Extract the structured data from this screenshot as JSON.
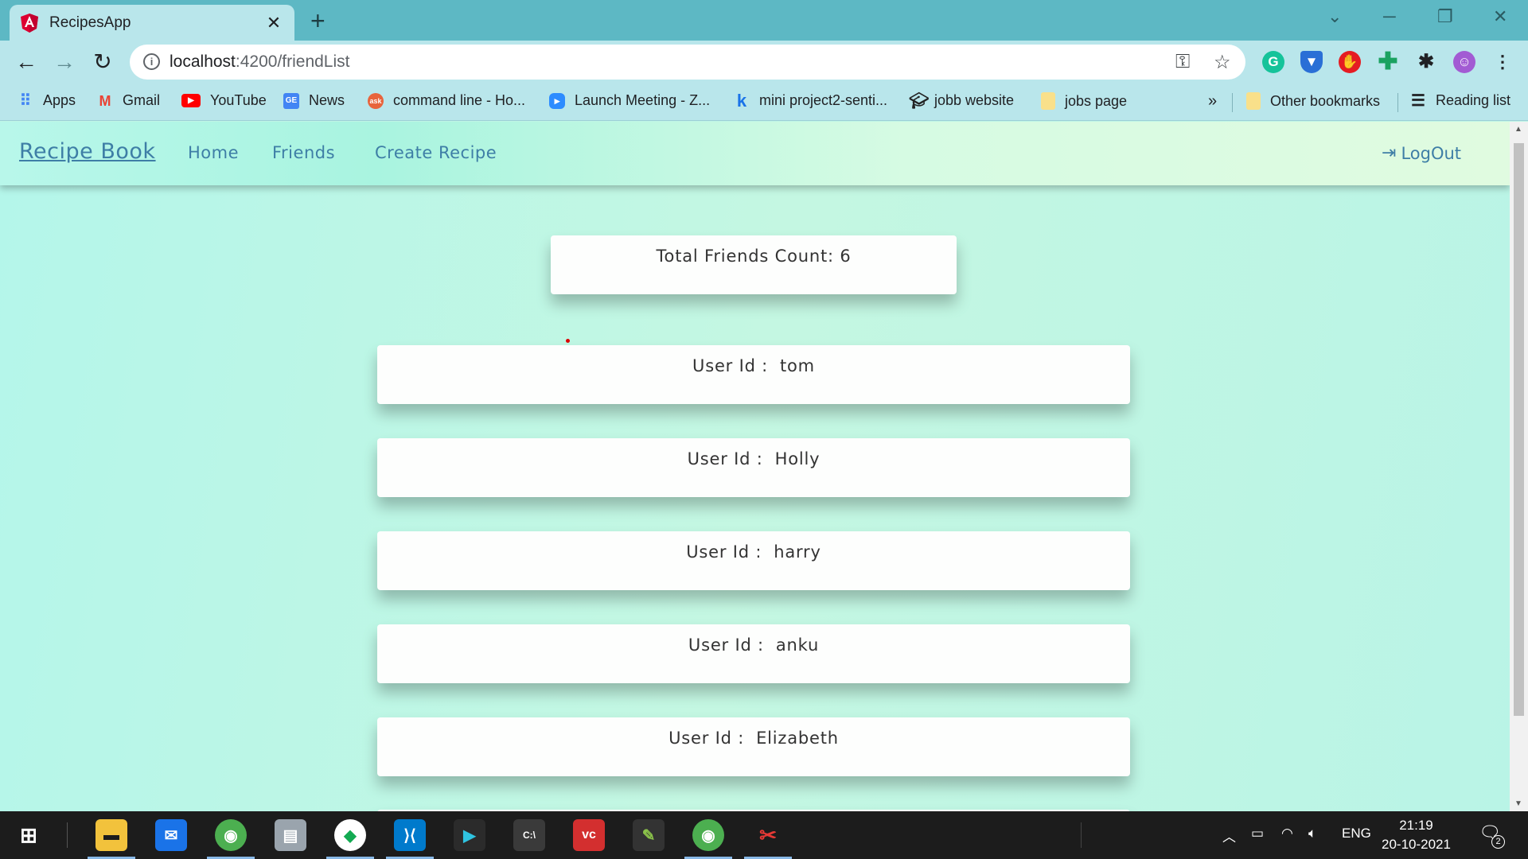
{
  "browser": {
    "tab_title": "RecipesApp",
    "tab_close": "✕",
    "new_tab": "+",
    "url_host": "localhost",
    "url_rest": ":4200/friendList",
    "bookmarks": [
      {
        "label": "Apps",
        "icon": "apps-grid-icon",
        "color": "#4285f4"
      },
      {
        "label": "Gmail",
        "icon": "gmail-icon",
        "color": "#ea4335"
      },
      {
        "label": "YouTube",
        "icon": "youtube-icon",
        "color": "#ff0000"
      },
      {
        "label": "News",
        "icon": "google-news-icon",
        "color": "#4285f4"
      },
      {
        "label": "command line - Ho...",
        "icon": "ask-icon",
        "color": "#e8643c"
      },
      {
        "label": "Launch Meeting - Z...",
        "icon": "zoom-icon",
        "color": "#2d8cff"
      },
      {
        "label": "mini project2-senti...",
        "icon": "k-icon",
        "color": "#1a73e8"
      },
      {
        "label": "jobb website",
        "icon": "grad-cap-icon",
        "color": "#222222"
      },
      {
        "label": "jobs page",
        "icon": "folder-icon",
        "color": "#f9e08a"
      }
    ],
    "overflow": "»",
    "other_bookmarks": "Other bookmarks",
    "reading_list": "Reading list"
  },
  "navbar": {
    "brand": "Recipe Book",
    "links": [
      "Home",
      "Friends",
      "Create Recipe"
    ],
    "logout": "LogOut"
  },
  "friends": {
    "count_label": "Total Friends Count: 6",
    "user_prefix": "User Id :  ",
    "users": [
      "tom",
      "Holly",
      "harry",
      "anku",
      "Elizabeth"
    ]
  },
  "taskbar": {
    "time": "21:19",
    "date": "20-10-2021",
    "language": "ENG",
    "notification_count": "2"
  },
  "colors": {
    "accent_link": "#3e7ea6",
    "chrome_frame": "#5db8c4",
    "chrome_toolbar": "#b9e6eb"
  }
}
